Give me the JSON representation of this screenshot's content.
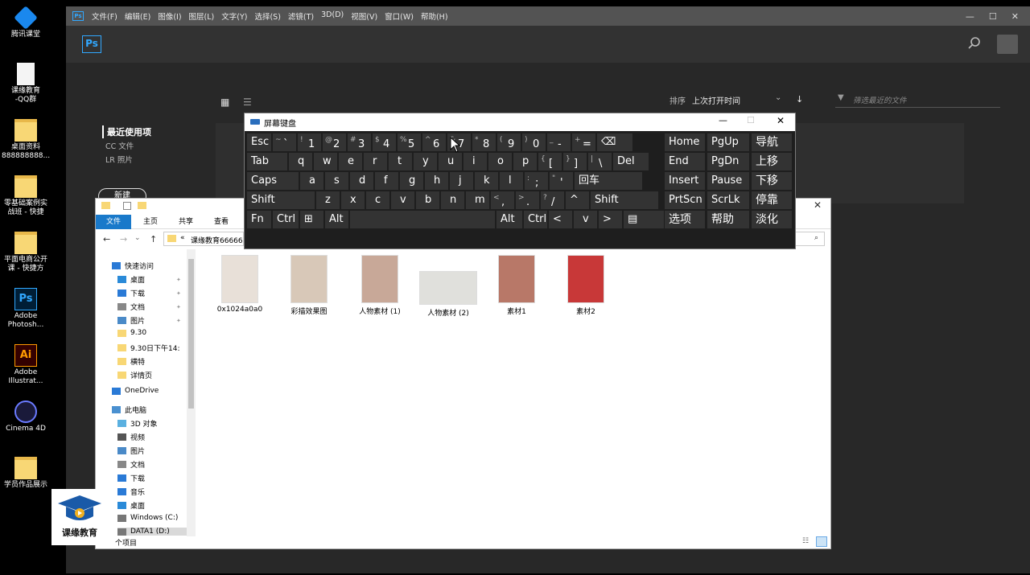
{
  "desktop": {
    "icons": [
      {
        "label": "腾讯课堂",
        "icon": "tencent-classroom-icon"
      },
      {
        "label": "课缘教育\n-QQ群",
        "icon": "document-icon"
      },
      {
        "label": "桌面资料\n888888888...",
        "icon": "folder-icon"
      },
      {
        "label": "零基础案例实\n战班 - 快捷",
        "icon": "folder-shortcut-icon"
      },
      {
        "label": "平面电商公开\n课 - 快捷方",
        "icon": "folder-shortcut-icon"
      },
      {
        "label": "Adobe\nPhotosh...",
        "icon": "photoshop-icon"
      },
      {
        "label": "Adobe\nIllustrat...",
        "icon": "illustrator-icon"
      },
      {
        "label": "Cinema 4D",
        "icon": "cinema4d-icon"
      },
      {
        "label": "学员作品展示",
        "icon": "folder-icon"
      }
    ]
  },
  "photoshop": {
    "app_icon": "Ps",
    "menu": [
      "文件(F)",
      "编辑(E)",
      "图像(I)",
      "图层(L)",
      "文字(Y)",
      "选择(S)",
      "滤镜(T)",
      "3D(D)",
      "视图(V)",
      "窗口(W)",
      "帮助(H)"
    ],
    "logo": "Ps",
    "sidebar": {
      "recent": "最近使用项",
      "cc_files": "CC 文件",
      "lr_photos": "LR 照片",
      "new_button": "新建"
    },
    "sort_label": "排序",
    "sort_value": "上次打开时间",
    "filter_placeholder": "筛选最近的文件"
  },
  "osk": {
    "title": "屏幕键盘",
    "rows": [
      [
        [
          "Esc",
          ""
        ],
        [
          "`",
          "~"
        ],
        [
          "1",
          "!"
        ],
        [
          "2",
          "@"
        ],
        [
          "3",
          "#"
        ],
        [
          "4",
          "$"
        ],
        [
          "5",
          "%"
        ],
        [
          "6",
          "^"
        ],
        [
          "7",
          "&"
        ],
        [
          "8",
          "*"
        ],
        [
          "9",
          "("
        ],
        [
          "0",
          ")"
        ],
        [
          "-",
          "_"
        ],
        [
          "=",
          "+"
        ],
        [
          "⌫",
          ""
        ]
      ],
      [
        [
          "Tab",
          ""
        ],
        [
          "q",
          ""
        ],
        [
          "w",
          ""
        ],
        [
          "e",
          ""
        ],
        [
          "r",
          ""
        ],
        [
          "t",
          ""
        ],
        [
          "y",
          ""
        ],
        [
          "u",
          ""
        ],
        [
          "i",
          ""
        ],
        [
          "o",
          ""
        ],
        [
          "p",
          ""
        ],
        [
          "[",
          "{"
        ],
        [
          "]",
          "}"
        ],
        [
          "\\",
          "|"
        ],
        [
          "Del",
          ""
        ]
      ],
      [
        [
          "Caps",
          ""
        ],
        [
          "a",
          ""
        ],
        [
          "s",
          ""
        ],
        [
          "d",
          ""
        ],
        [
          "f",
          ""
        ],
        [
          "g",
          ""
        ],
        [
          "h",
          ""
        ],
        [
          "j",
          ""
        ],
        [
          "k",
          ""
        ],
        [
          "l",
          ""
        ],
        [
          ";",
          ":"
        ],
        [
          "'",
          "\""
        ],
        [
          "回车",
          ""
        ]
      ],
      [
        [
          "Shift",
          ""
        ],
        [
          "z",
          ""
        ],
        [
          "x",
          ""
        ],
        [
          "c",
          ""
        ],
        [
          "v",
          ""
        ],
        [
          "b",
          ""
        ],
        [
          "n",
          ""
        ],
        [
          "m",
          ""
        ],
        [
          ",",
          "<"
        ],
        [
          ".",
          ">"
        ],
        [
          "/",
          "?"
        ],
        [
          "^",
          ""
        ],
        [
          "Shift",
          ""
        ]
      ],
      [
        [
          "Fn",
          ""
        ],
        [
          "Ctrl",
          ""
        ],
        [
          "⊞",
          ""
        ],
        [
          "Alt",
          ""
        ],
        [
          "",
          ""
        ],
        [
          "Alt",
          ""
        ],
        [
          "Ctrl",
          ""
        ],
        [
          "<",
          ""
        ],
        [
          "v",
          ""
        ],
        [
          ">",
          ""
        ],
        [
          "▤",
          ""
        ]
      ]
    ],
    "right_keys": [
      [
        "Home",
        "PgUp",
        "导航"
      ],
      [
        "End",
        "PgDn",
        "上移"
      ],
      [
        "Insert",
        "Pause",
        "下移"
      ],
      [
        "PrtScn",
        "ScrLk",
        "停靠"
      ],
      [
        "选项",
        "帮助",
        "淡化"
      ]
    ]
  },
  "explorer": {
    "tabs": [
      "文件",
      "主页",
      "共享",
      "查看"
    ],
    "path": "课缘教育66666",
    "nav": [
      {
        "label": "快速访问",
        "icon": "star-icon",
        "indent": 0
      },
      {
        "label": "桌面",
        "icon": "desktop-icon",
        "indent": 1
      },
      {
        "label": "下载",
        "icon": "download-icon",
        "indent": 1
      },
      {
        "label": "文档",
        "icon": "document-icon",
        "indent": 1
      },
      {
        "label": "图片",
        "icon": "picture-icon",
        "indent": 1
      },
      {
        "label": "9.30",
        "icon": "folder-icon",
        "indent": 1
      },
      {
        "label": "9.30日下午14:",
        "icon": "folder-icon",
        "indent": 1
      },
      {
        "label": "横特",
        "icon": "folder-icon",
        "indent": 1
      },
      {
        "label": "详情页",
        "icon": "folder-icon",
        "indent": 1
      },
      {
        "label": "OneDrive",
        "icon": "cloud-icon",
        "indent": 0
      },
      {
        "label": "此电脑",
        "icon": "computer-icon",
        "indent": 0
      },
      {
        "label": "3D 对象",
        "icon": "cube-icon",
        "indent": 1
      },
      {
        "label": "视频",
        "icon": "video-icon",
        "indent": 1
      },
      {
        "label": "图片",
        "icon": "picture-icon",
        "indent": 1
      },
      {
        "label": "文档",
        "icon": "document-icon",
        "indent": 1
      },
      {
        "label": "下载",
        "icon": "download-icon",
        "indent": 1
      },
      {
        "label": "音乐",
        "icon": "music-icon",
        "indent": 1
      },
      {
        "label": "桌面",
        "icon": "desktop-icon",
        "indent": 1
      },
      {
        "label": "Windows (C:)",
        "icon": "drive-icon",
        "indent": 1
      },
      {
        "label": "DATA1 (D:)",
        "icon": "drive-icon",
        "indent": 1
      }
    ],
    "files": [
      {
        "name": "0x1024a0a0",
        "color": "#e8e0d8"
      },
      {
        "name": "彩描效果图",
        "color": "#d8c8b8"
      },
      {
        "name": "人物素材 (1)",
        "color": "#c8a898"
      },
      {
        "name": "人物素材 (2)",
        "color": "#e0e0dc"
      },
      {
        "name": "素材1",
        "color": "#b87868"
      },
      {
        "name": "素材2",
        "color": "#c83838"
      }
    ],
    "status": "个项目"
  },
  "watermark": {
    "label": "课缘教育"
  }
}
